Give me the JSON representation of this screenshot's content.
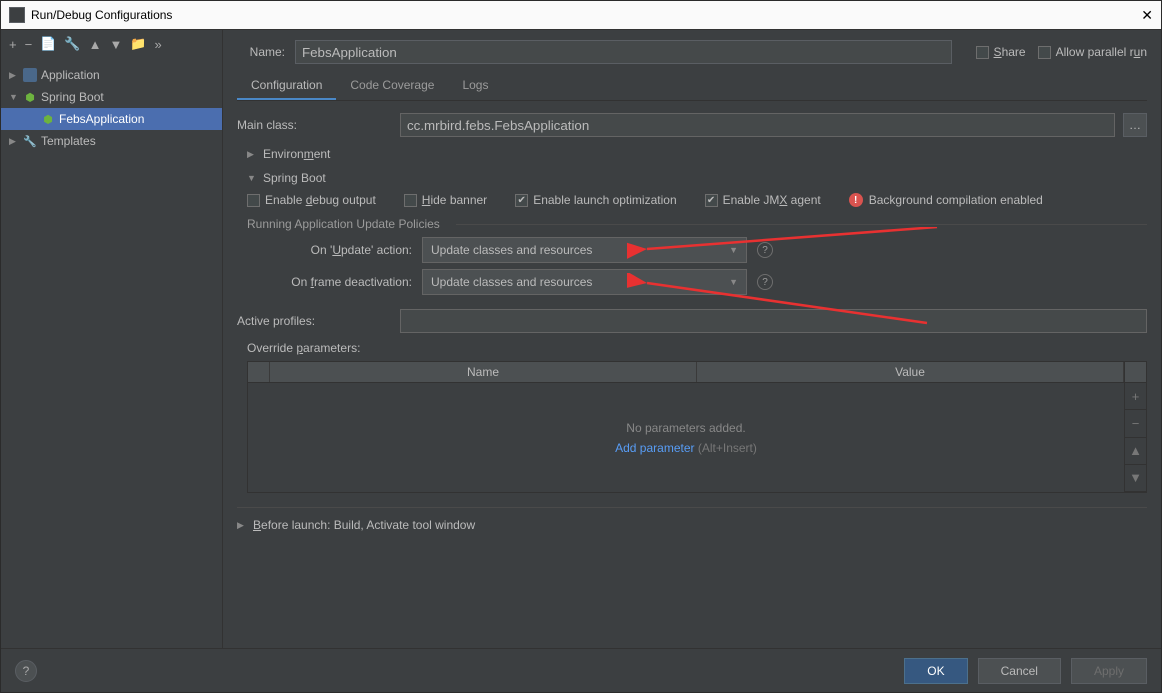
{
  "window": {
    "title": "Run/Debug Configurations"
  },
  "sidebar": {
    "items": [
      {
        "label": "Application",
        "expanded": false
      },
      {
        "label": "Spring Boot",
        "expanded": true
      },
      {
        "label": "FebsApplication",
        "selected": true
      },
      {
        "label": "Templates",
        "expanded": false
      }
    ]
  },
  "header": {
    "name_label": "Name:",
    "name_value": "FebsApplication",
    "share_label": "Share",
    "parallel_label": "Allow parallel run"
  },
  "tabs": [
    {
      "label": "Configuration",
      "active": true
    },
    {
      "label": "Code Coverage",
      "active": false
    },
    {
      "label": "Logs",
      "active": false
    }
  ],
  "form": {
    "main_class_label": "Main class:",
    "main_class_value": "cc.mrbird.febs.FebsApplication",
    "env_label": "Environment",
    "spring_boot_label": "Spring Boot",
    "checks": {
      "debug_output": "Enable debug output",
      "hide_banner": "Hide banner",
      "launch_opt": "Enable launch optimization",
      "jmx_agent": "Enable JMX agent"
    },
    "warn_text": "Background compilation enabled",
    "policies_group": "Running Application Update Policies",
    "update_action_label": "On 'Update' action:",
    "update_action_value": "Update classes and resources",
    "frame_deact_label": "On frame deactivation:",
    "frame_deact_value": "Update classes and resources",
    "active_profiles_label": "Active profiles:",
    "active_profiles_value": "",
    "override_params_label": "Override parameters:",
    "table": {
      "col_name": "Name",
      "col_value": "Value",
      "empty_msg": "No parameters added.",
      "add_link": "Add parameter",
      "add_hint": "(Alt+Insert)"
    },
    "before_launch_label": "Before launch: Build, Activate tool window"
  },
  "footer": {
    "ok": "OK",
    "cancel": "Cancel",
    "apply": "Apply"
  }
}
